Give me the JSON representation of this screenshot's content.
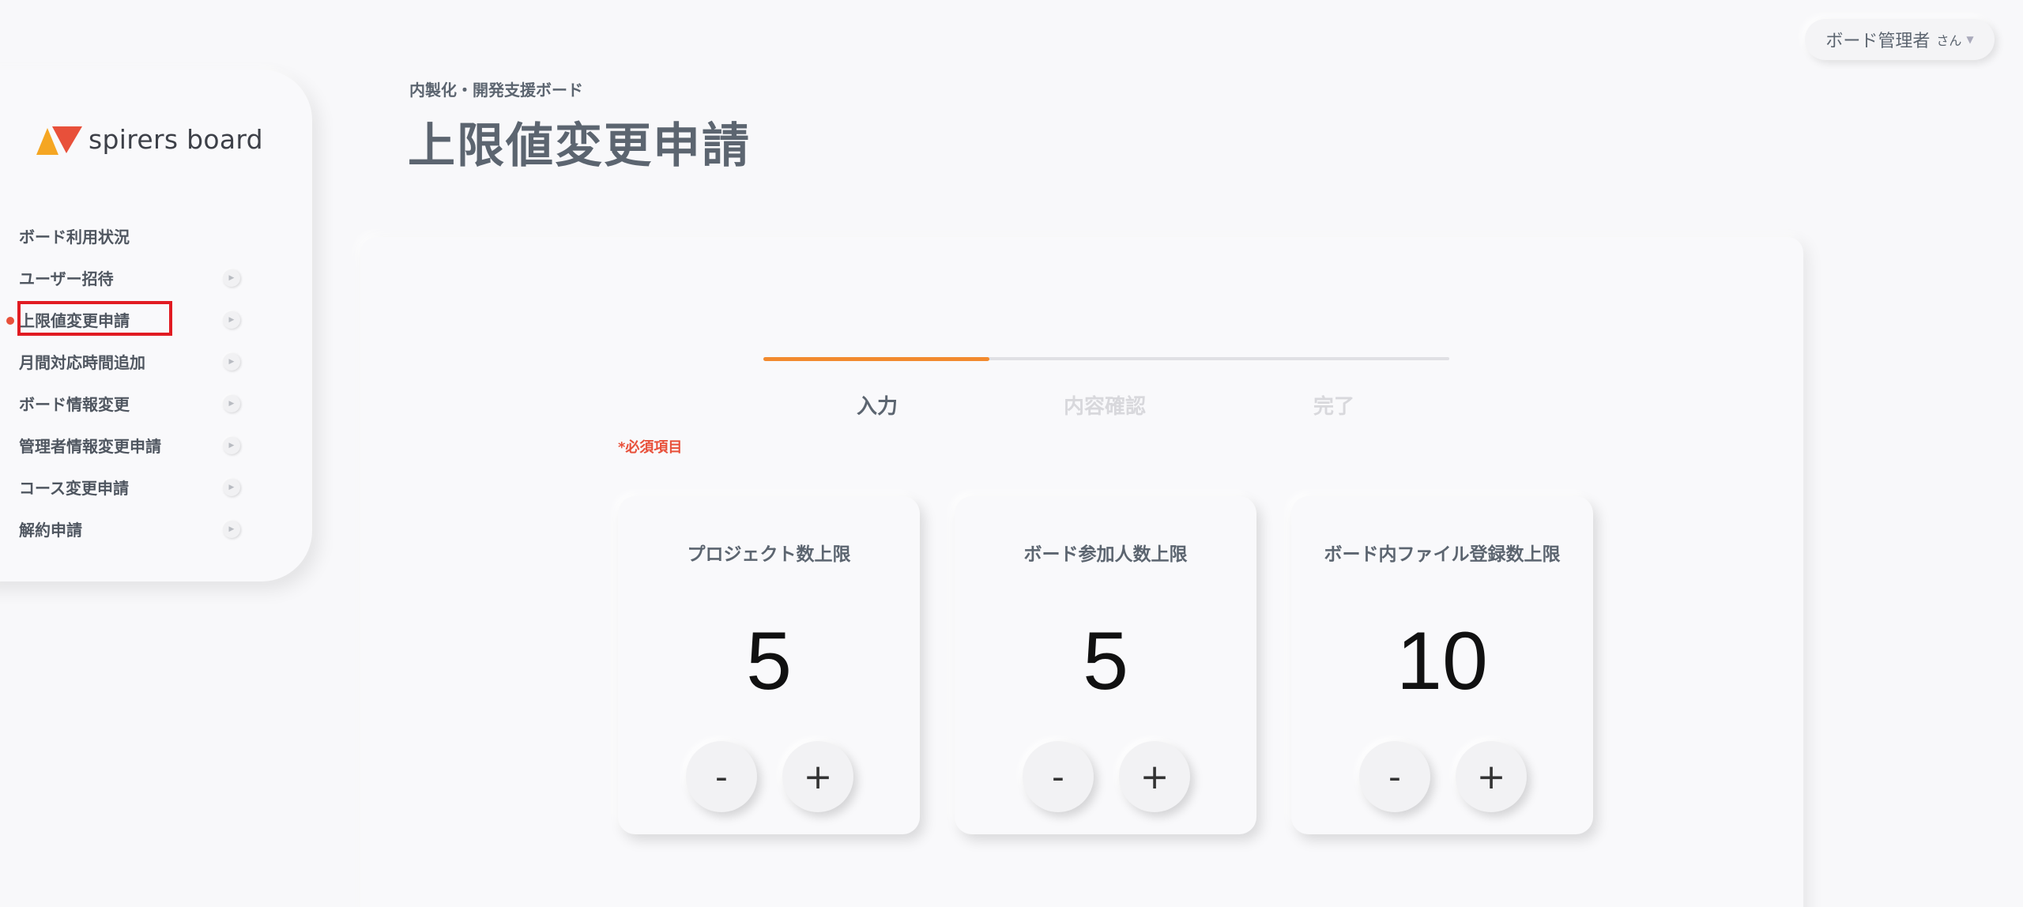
{
  "user_menu": {
    "name": "ボード管理者",
    "suffix": "さん"
  },
  "logo": {
    "text": "spirers board"
  },
  "sidebar": {
    "items": [
      {
        "label": "ボード利用状況"
      },
      {
        "label": "ユーザー招待"
      },
      {
        "label": "上限値変更申請"
      },
      {
        "label": "月間対応時間追加"
      },
      {
        "label": "ボード情報変更"
      },
      {
        "label": "管理者情報変更申請"
      },
      {
        "label": "コース変更申請"
      },
      {
        "label": "解約申請"
      }
    ]
  },
  "header": {
    "breadcrumb": "内製化・開発支援ボード",
    "title": "上限値変更申請"
  },
  "steps": {
    "progress": 0.33,
    "items": [
      {
        "label": "入力"
      },
      {
        "label": "内容確認"
      },
      {
        "label": "完了"
      }
    ]
  },
  "required_note": "*必須項目",
  "cards": [
    {
      "title": "プロジェクト数上限",
      "value": "5"
    },
    {
      "title": "ボード参加人数上限",
      "value": "5"
    },
    {
      "title": "ボード内ファイル登録数上限",
      "value": "10"
    }
  ],
  "buttons": {
    "minus": "-",
    "plus": "+"
  },
  "colors": {
    "accent": "#f28a2e",
    "active_dot": "#e8503a",
    "highlight_box": "#e11b22",
    "logo_orange": "#f5a623",
    "logo_red": "#e8503a"
  }
}
